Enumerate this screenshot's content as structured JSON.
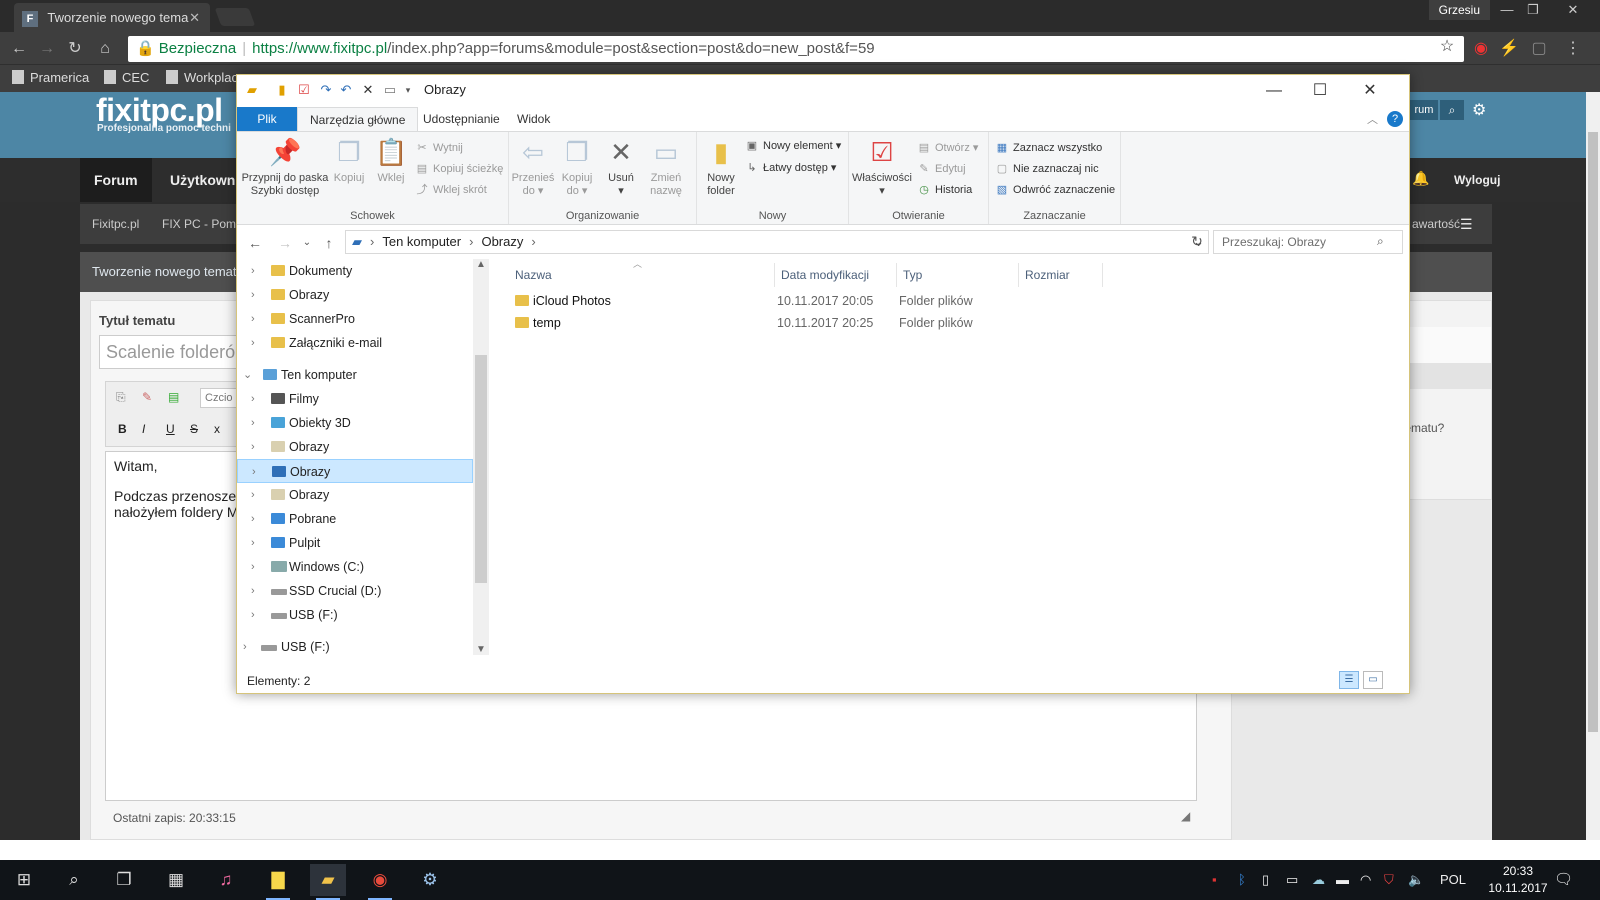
{
  "browser": {
    "tab_title": "Tworzenie nowego tema",
    "tab_favicon": "F",
    "user_name": "Grzesiu",
    "security_label": "Bezpieczna",
    "url_host": "https://www.fixitpc.pl",
    "url_path": "/index.php?app=forums&module=post&section=post&do=new_post&f=59",
    "bookmarks": [
      "Pramerica",
      "CEC",
      "Workplac"
    ]
  },
  "site": {
    "logo": "fixitpc.pl",
    "tagline": "Profesjonalna pomoc techni",
    "nav": [
      "Forum",
      "Użytkowni"
    ],
    "nav_right": "Wyloguj",
    "search_btn": "rum",
    "breadcrumb": [
      "Fixitpc.pl",
      "FIX PC - Pomo"
    ],
    "breadcrumb_right": "awartość",
    "page_header": "Tworzenie nowego tematu",
    "topic_label": "Tytuł tematu",
    "topic_value": "Scalenie folderó",
    "font_placeholder": "Czcio",
    "editor_line1": "Witam,",
    "editor_line2": "Podczas przenosze",
    "editor_line3": "nałożyłem foldery M",
    "autosave": "Ostatni zapis: 20:33:15",
    "side_text": "tematu?"
  },
  "explorer": {
    "title": "Obrazy",
    "ribbon_tabs": [
      "Plik",
      "Narzędzia główne",
      "Udostępnianie",
      "Widok"
    ],
    "clipboard": {
      "pin": "Przypnij do paska Szybki dostęp",
      "copy": "Kopiuj",
      "paste": "Wklej",
      "cut": "Wytnij",
      "copy_path": "Kopiuj ścieżkę",
      "paste_shortcut": "Wklej skrót",
      "group": "Schowek"
    },
    "organize": {
      "move_to": "Przenieś do",
      "copy_to": "Kopiuj do",
      "delete": "Usuń",
      "rename": "Zmień nazwę",
      "group": "Organizowanie"
    },
    "new": {
      "new_folder": "Nowy folder",
      "new_item": "Nowy element",
      "easy_access": "Łatwy dostęp",
      "group": "Nowy"
    },
    "open": {
      "properties": "Właściwości",
      "open": "Otwórz",
      "edit": "Edytuj",
      "history": "Historia",
      "group": "Otwieranie"
    },
    "select": {
      "select_all": "Zaznacz wszystko",
      "select_none": "Nie zaznaczaj nic",
      "invert": "Odwróć zaznaczenie",
      "group": "Zaznaczanie"
    },
    "path": [
      "Ten komputer",
      "Obrazy"
    ],
    "search_placeholder": "Przeszukaj: Obrazy",
    "tree": [
      {
        "label": "Dokumenty"
      },
      {
        "label": "Obrazy"
      },
      {
        "label": "ScannerPro"
      },
      {
        "label": "Załączniki e-mail"
      },
      {
        "label": "Ten komputer"
      },
      {
        "label": "Filmy"
      },
      {
        "label": "Obiekty 3D"
      },
      {
        "label": "Obrazy"
      },
      {
        "label": "Obrazy"
      },
      {
        "label": "Obrazy"
      },
      {
        "label": "Pobrane"
      },
      {
        "label": "Pulpit"
      },
      {
        "label": "Windows (C:)"
      },
      {
        "label": "SSD Crucial (D:)"
      },
      {
        "label": "USB (F:)"
      },
      {
        "label": "USB (F:)"
      }
    ],
    "columns": [
      "Nazwa",
      "Data modyfikacji",
      "Typ",
      "Rozmiar"
    ],
    "files": [
      {
        "name": "iCloud Photos",
        "date": "10.11.2017 20:05",
        "type": "Folder plików"
      },
      {
        "name": "temp",
        "date": "10.11.2017 20:25",
        "type": "Folder plików"
      }
    ],
    "status": "Elementy: 2"
  },
  "taskbar": {
    "lang": "POL",
    "time": "20:33",
    "date": "10.11.2017"
  }
}
